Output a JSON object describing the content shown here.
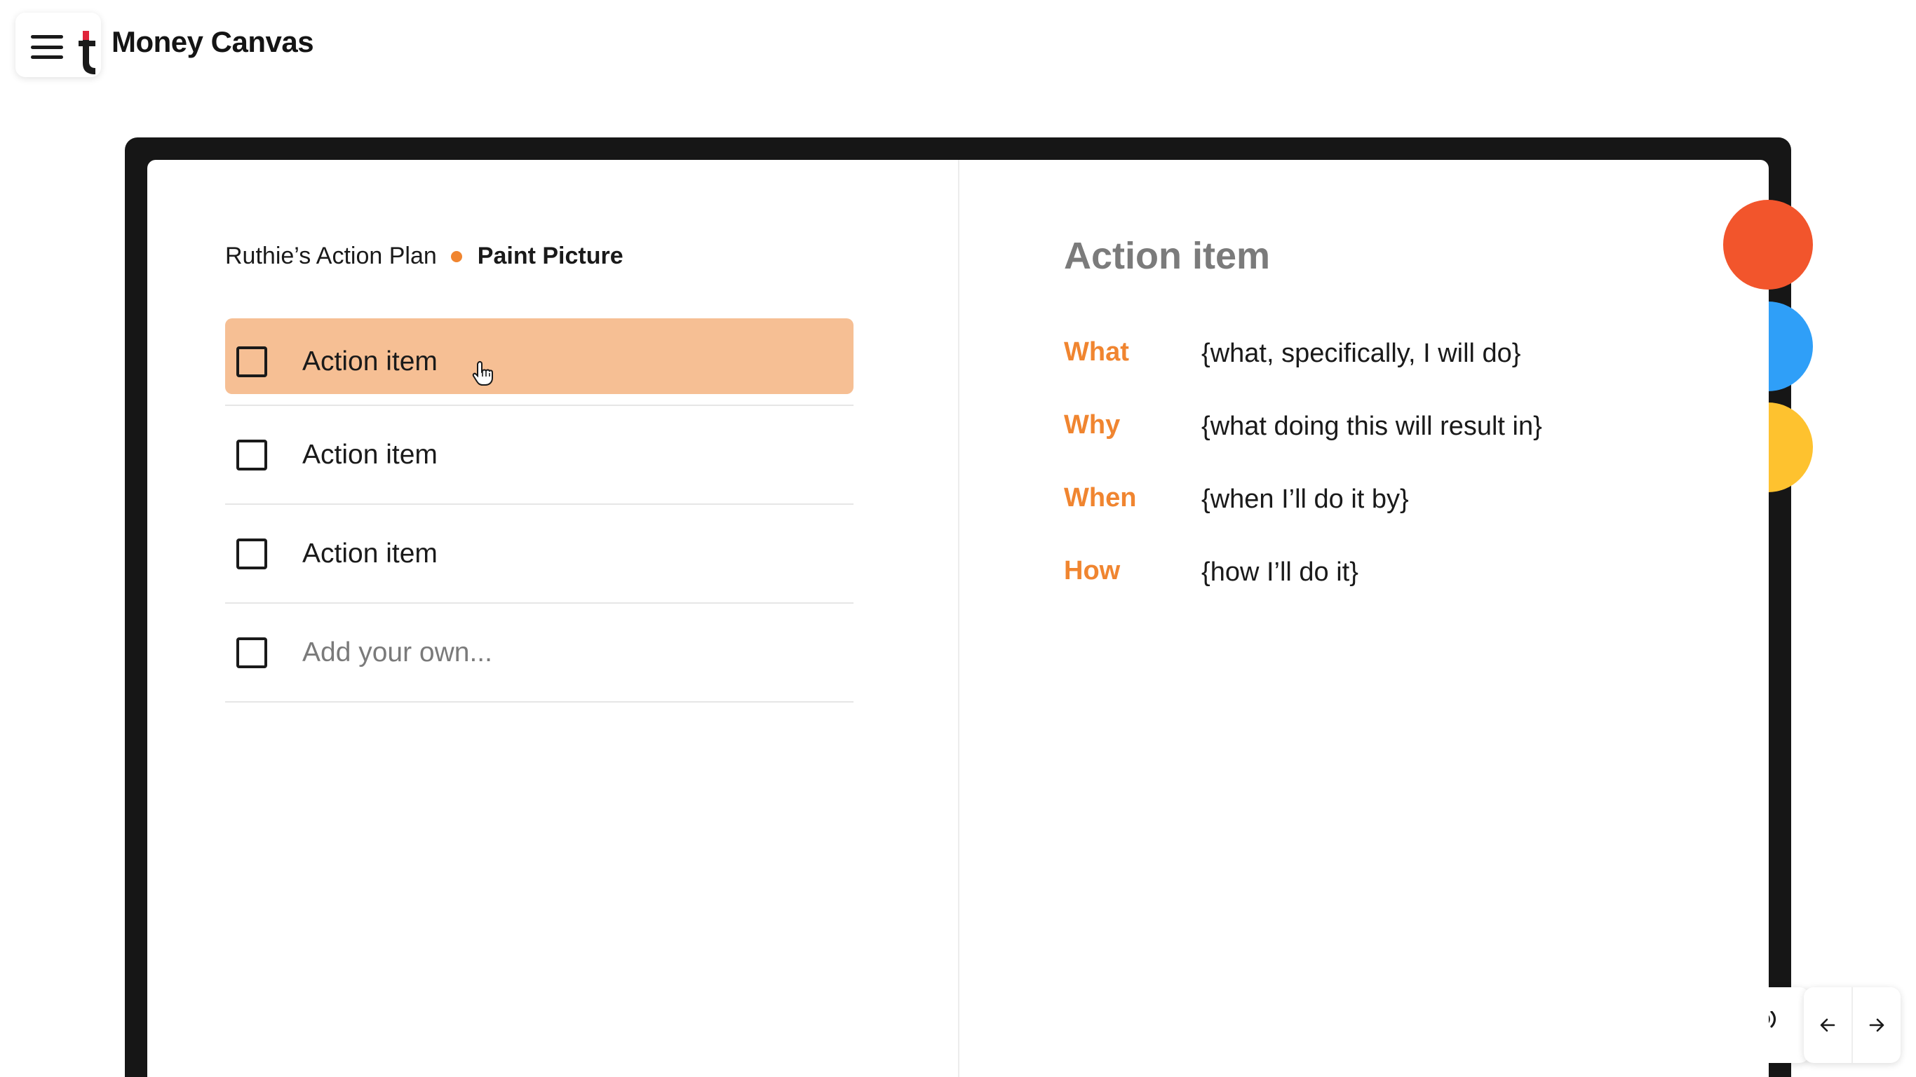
{
  "header": {
    "app_title": "Money Canvas",
    "menu_icon": "hamburger-icon",
    "logo_icon": "t-logo-icon"
  },
  "breadcrumb": {
    "parent": "Ruthie’s Action Plan",
    "current": "Paint Picture"
  },
  "action_list": {
    "items": [
      {
        "label": "Action item",
        "checked": false,
        "highlighted": true
      },
      {
        "label": "Action item",
        "checked": false,
        "highlighted": false
      },
      {
        "label": "Action item",
        "checked": false,
        "highlighted": false
      }
    ],
    "add_placeholder": "Add your own..."
  },
  "detail": {
    "title": "Action item",
    "rows": [
      {
        "key": "What",
        "value": "{what, specifically, I will do}"
      },
      {
        "key": "Why",
        "value": "{what doing this will result in}"
      },
      {
        "key": "When",
        "value": "{when I’ll do it by}"
      },
      {
        "key": "How",
        "value": "{how I’ll do it}"
      }
    ]
  },
  "controls": {
    "audio_icon": "speaking-person-icon",
    "prev_icon": "arrow-left-icon",
    "next_icon": "arrow-right-icon"
  },
  "colors": {
    "accent_orange": "#f08530",
    "highlight_row": "#f6bf94",
    "logo_red": "#e0243a",
    "tab_red": "#f2552c",
    "tab_blue": "#2f9ff8",
    "tab_yellow": "#fec22f",
    "frame_black": "#161616"
  }
}
